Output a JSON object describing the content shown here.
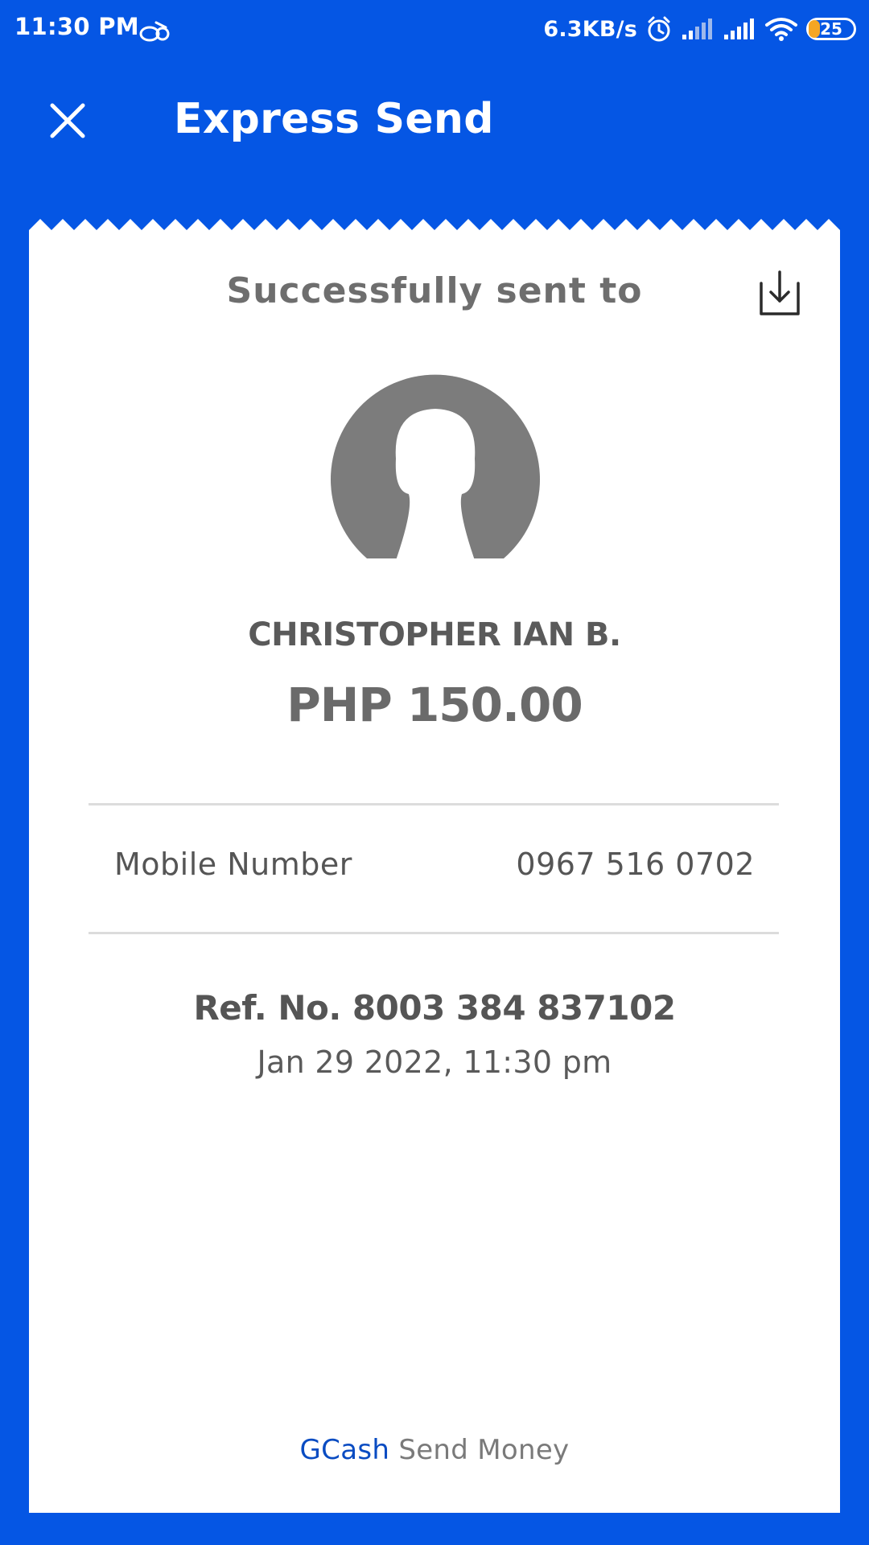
{
  "status_bar": {
    "time": "11:30 PM",
    "network_speed": "6.3KB/s",
    "battery_level": "25",
    "battery_fraction": 0.25,
    "icons": [
      "notification-icon",
      "alarm-icon",
      "signal-icon",
      "signal-icon",
      "wifi-icon",
      "battery-icon"
    ]
  },
  "header": {
    "title": "Express Send",
    "close_icon": "close-icon"
  },
  "receipt": {
    "heading": "Successfully sent to",
    "download_icon": "download-icon",
    "avatar_icon": "avatar-placeholder",
    "recipient_name": "CHRISTOPHER IAN B.",
    "amount": "PHP 150.00",
    "details": [
      {
        "label": "Mobile Number",
        "value": "0967 516 0702"
      }
    ],
    "ref_number": "Ref. No. 8003 384 837102",
    "timestamp": "Jan 29 2022, 11:30 pm",
    "footer": {
      "brand": "GCash",
      "service": "Send Money"
    }
  },
  "colors": {
    "primary": "#0556E4",
    "card": "#FFFFFF",
    "brand_text": "#0A4CC2",
    "battery_accent": "#F5A623"
  }
}
